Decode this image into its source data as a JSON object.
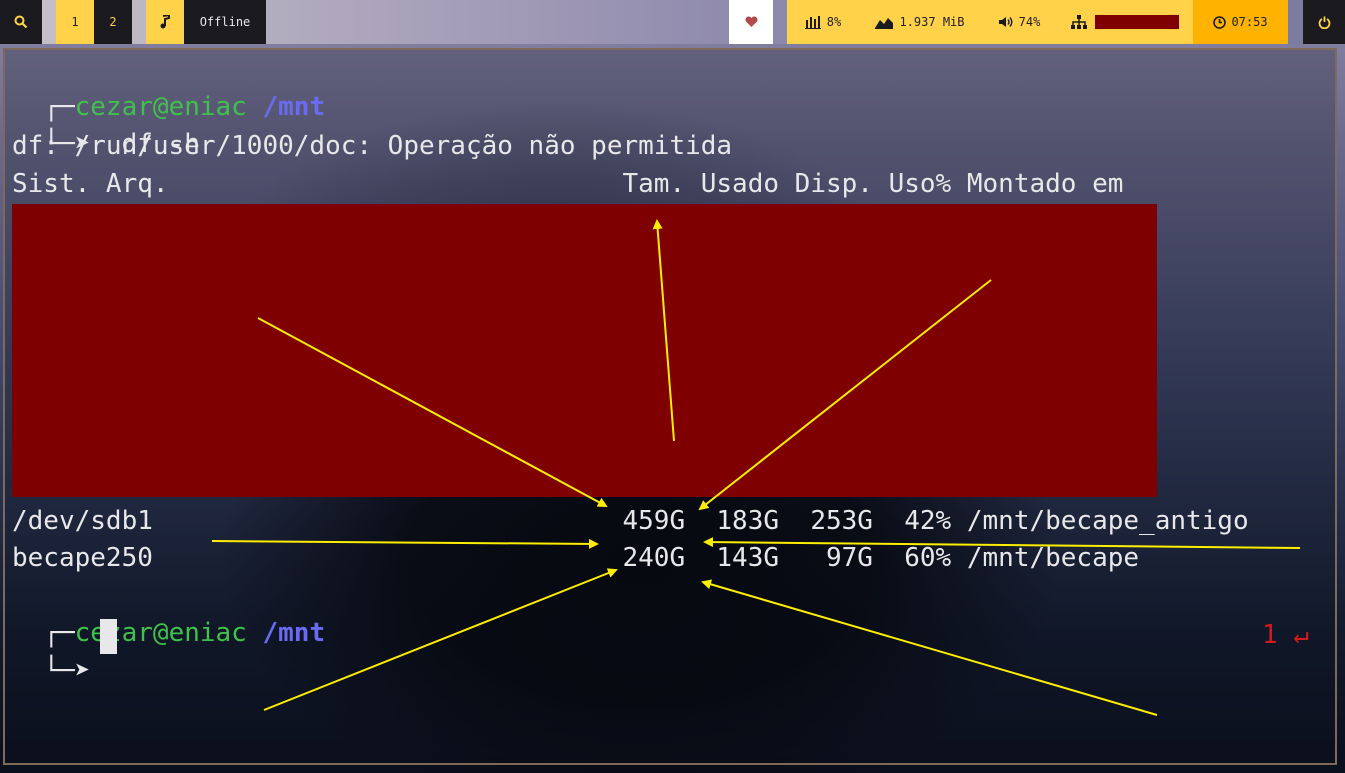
{
  "statusbar": {
    "workspaces": [
      "1",
      "2"
    ],
    "media_status": "Offline",
    "cpu": "8%",
    "memory": "1.937 MiB",
    "volume": "74%",
    "clock": "07:53",
    "icons": [
      "search-icon",
      "music-note-icon",
      "heart-icon",
      "bar-chart-icon",
      "memory-area-icon",
      "speaker-icon",
      "network-icon",
      "clock-icon",
      "power-icon"
    ],
    "colors": {
      "accent_yellow": "#ffd24a",
      "accent_orange": "#ffb300",
      "dark": "#1b1b1f",
      "redact": "#7f0000"
    }
  },
  "terminal": {
    "prompt1": {
      "user": "cezar",
      "at": "@",
      "host": "eniac",
      "path": "/mnt",
      "command": "df -h"
    },
    "error": "df: /run/user/1000/doc: Operação não permitida",
    "header": "Sist. Arq.                             Tam. Usado Disp. Uso% Montado em",
    "rows": [
      "/dev/sdb1                              459G  183G  253G  42% /mnt/becape_antigo",
      "becape250                              240G  143G   97G  60% /mnt/becape"
    ],
    "prompt2": {
      "user": "cezar",
      "at": "@",
      "host": "eniac",
      "path": "/mnt"
    },
    "exit_status": "1 ↵"
  }
}
